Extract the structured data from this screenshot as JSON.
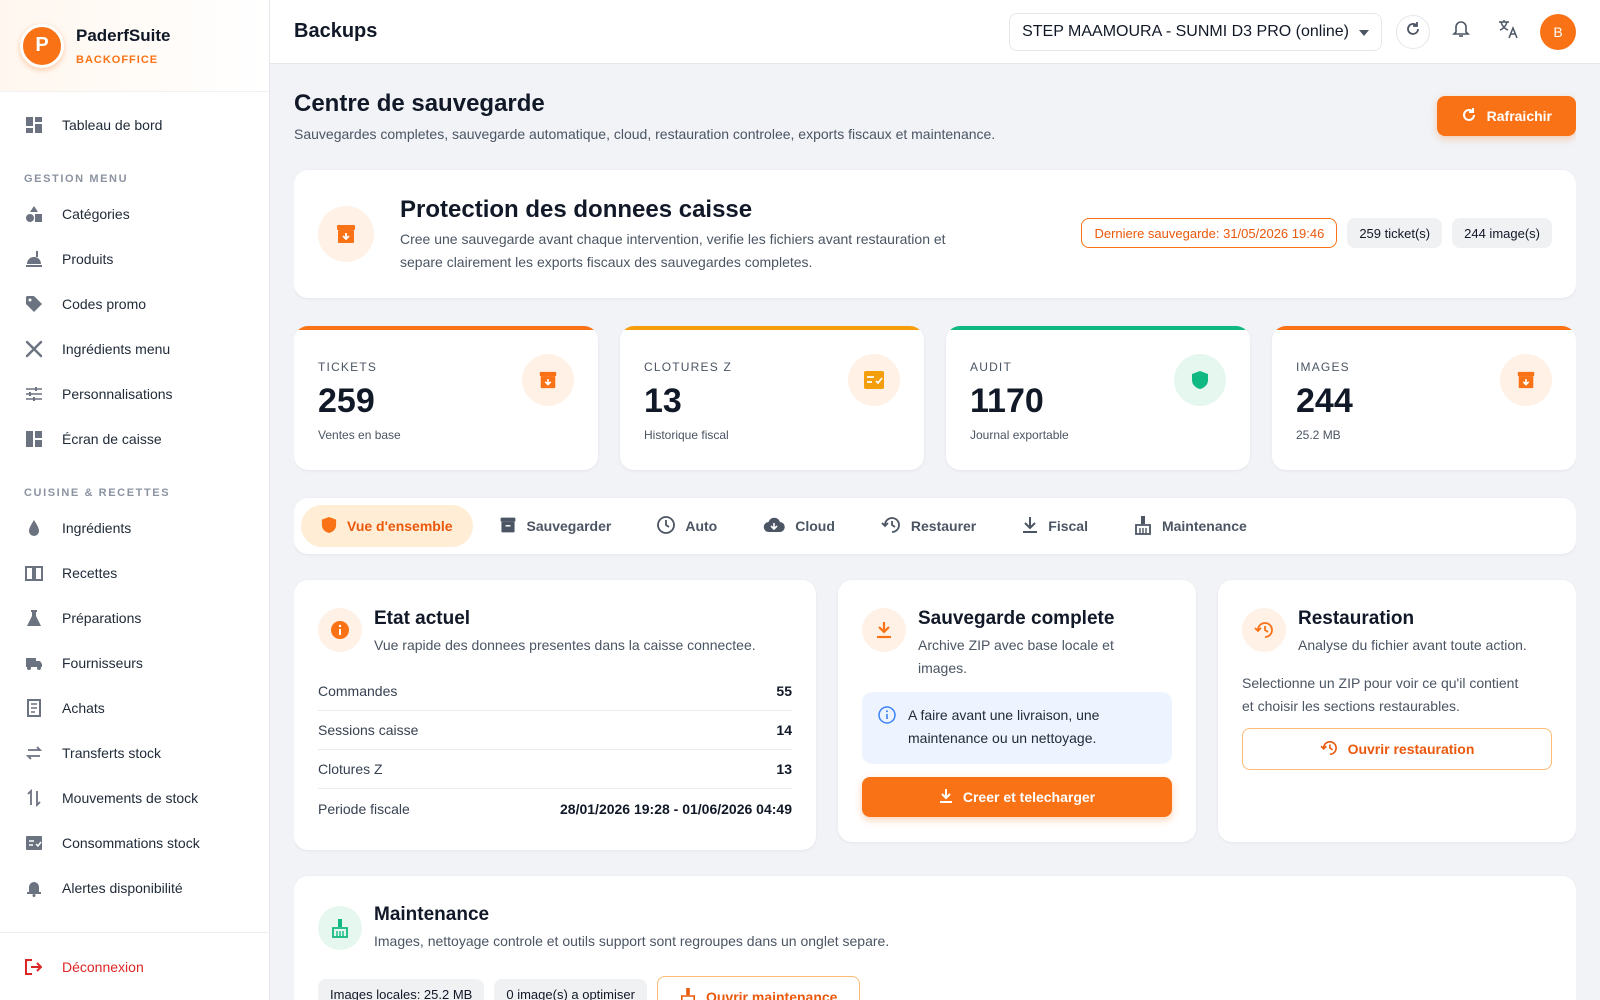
{
  "brand": {
    "name": "PaderfSuite",
    "subtitle": "BACKOFFICE",
    "logo_letter": "P"
  },
  "sidebar": {
    "top_item": {
      "label": "Tableau de bord",
      "icon": "dashboard-icon"
    },
    "sections": [
      {
        "title": "GESTION MENU",
        "items": [
          {
            "label": "Catégories",
            "icon": "shapes-icon"
          },
          {
            "label": "Produits",
            "icon": "food-icon"
          },
          {
            "label": "Codes promo",
            "icon": "tag-icon"
          },
          {
            "label": "Ingrédients menu",
            "icon": "utensils-icon"
          },
          {
            "label": "Personnalisations",
            "icon": "sliders-icon"
          },
          {
            "label": "Écran de caisse",
            "icon": "layout-icon"
          }
        ]
      },
      {
        "title": "CUISINE & RECETTES",
        "items": [
          {
            "label": "Ingrédients",
            "icon": "drop-icon"
          },
          {
            "label": "Recettes",
            "icon": "book-icon"
          },
          {
            "label": "Préparations",
            "icon": "flask-icon"
          },
          {
            "label": "Fournisseurs",
            "icon": "truck-icon"
          },
          {
            "label": "Achats",
            "icon": "receipt-icon"
          },
          {
            "label": "Transferts stock",
            "icon": "transfer-icon"
          },
          {
            "label": "Mouvements de stock",
            "icon": "sort-icon"
          },
          {
            "label": "Consommations stock",
            "icon": "checklist-icon"
          },
          {
            "label": "Alertes disponibilité",
            "icon": "alarm-icon"
          }
        ]
      }
    ],
    "logout": "Déconnexion"
  },
  "topbar": {
    "title": "Backups",
    "device": "STEP MAAMOURA - SUNMI D3 PRO (online)",
    "avatar": "B"
  },
  "header": {
    "title": "Centre de sauvegarde",
    "subtitle": "Sauvegardes completes, sauvegarde automatique, cloud, restauration controlee, exports fiscaux et maintenance.",
    "refresh": "Rafraichir"
  },
  "protection": {
    "title": "Protection des donnees caisse",
    "text_line1": "Cree une sauvegarde avant chaque intervention, verifie les fichiers avant restauration et",
    "text_line2": "separe clairement les exports fiscaux des sauvegardes completes.",
    "last_backup": "Derniere sauvegarde: 31/05/2026 19:46",
    "tickets_badge": "259 ticket(s)",
    "images_badge": "244 image(s)"
  },
  "stats": [
    {
      "label": "TICKETS",
      "value": "259",
      "caption": "Ventes en base",
      "color": "#f97316",
      "icon": "archive-icon"
    },
    {
      "label": "CLOTURES Z",
      "value": "13",
      "caption": "Historique fiscal",
      "color": "#f59e0b",
      "icon": "checklist-icon"
    },
    {
      "label": "AUDIT",
      "value": "1170",
      "caption": "Journal exportable",
      "color": "#10b981",
      "icon": "shield-icon"
    },
    {
      "label": "IMAGES",
      "value": "244",
      "caption": "25.2 MB",
      "color": "#f97316",
      "icon": "archive-icon"
    }
  ],
  "tabs": [
    {
      "label": "Vue d'ensemble",
      "icon": "shield-icon",
      "active": true
    },
    {
      "label": "Sauvegarder",
      "icon": "archive-icon"
    },
    {
      "label": "Auto",
      "icon": "clock-icon"
    },
    {
      "label": "Cloud",
      "icon": "cloud-download-icon"
    },
    {
      "label": "Restaurer",
      "icon": "history-icon"
    },
    {
      "label": "Fiscal",
      "icon": "download-icon"
    },
    {
      "label": "Maintenance",
      "icon": "broom-icon"
    }
  ],
  "etat": {
    "title": "Etat actuel",
    "subtitle": "Vue rapide des donnees presentes dans la caisse connectee.",
    "rows": [
      {
        "label": "Commandes",
        "value": "55"
      },
      {
        "label": "Sessions caisse",
        "value": "14"
      },
      {
        "label": "Clotures Z",
        "value": "13"
      },
      {
        "label": "Periode fiscale",
        "value": "28/01/2026 19:28 - 01/06/2026 04:49"
      }
    ]
  },
  "sauvegarde": {
    "title": "Sauvegarde complete",
    "subtitle_line1": "Archive ZIP avec base locale et",
    "subtitle_line2": "images.",
    "info_line1": "A faire avant une livraison, une",
    "info_line2": "maintenance ou un nettoyage.",
    "button": "Creer et telecharger"
  },
  "restauration": {
    "title": "Restauration",
    "subtitle": "Analyse du fichier avant toute action.",
    "text_line1": "Selectionne un ZIP pour voir ce qu'il contient",
    "text_line2": "et choisir les sections restaurables.",
    "button": "Ouvrir restauration"
  },
  "maintenance": {
    "title": "Maintenance",
    "subtitle": "Images, nettoyage controle et outils support sont regroupes dans un onglet separe.",
    "badge1": "Images locales: 25.2 MB",
    "badge2": "0 image(s) a optimiser",
    "button": "Ouvrir maintenance"
  },
  "colors": {
    "accent": "#f97316",
    "danger": "#dc2626",
    "success": "#10b981"
  }
}
